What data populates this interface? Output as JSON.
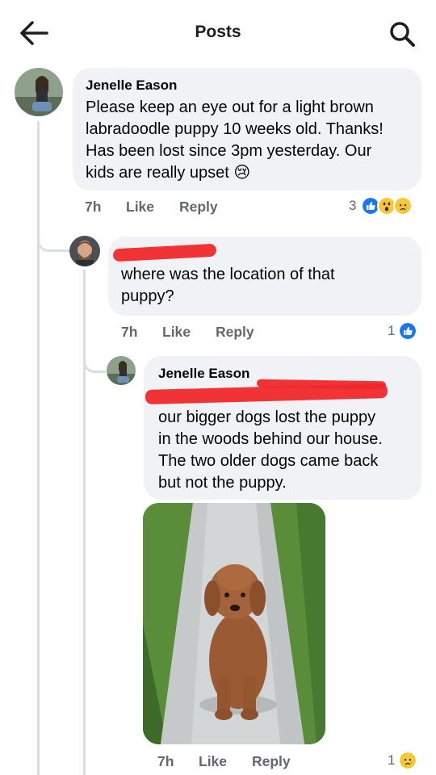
{
  "header": {
    "title": "Posts",
    "back_icon": "arrow-left-icon",
    "search_icon": "search-icon"
  },
  "comments": [
    {
      "author": "Jenelle Eason",
      "text_lines": [
        "Please keep an eye out for a light brown",
        "labradoodle puppy 10 weeks old. Thanks!",
        "Has been lost since 3pm yesterday. Our",
        "kids are really upset 😢"
      ],
      "time": "7h",
      "like": "Like",
      "reply": "Reply",
      "reaction_count": "3"
    },
    {
      "author": "",
      "text_lines": [
        "where was the location of that",
        "puppy?"
      ],
      "time": "7h",
      "like": "Like",
      "reply": "Reply",
      "reaction_count": "1"
    },
    {
      "author": "Jenelle Eason",
      "text_lines": [
        "our bigger dogs lost the puppy",
        "in the woods behind our house.",
        "The two older dogs came back",
        "but not the puppy."
      ],
      "time": "7h",
      "like": "Like",
      "reply": "Reply",
      "reaction_count": "1"
    }
  ],
  "colors": {
    "bubble": "#f0f2f5",
    "meta": "#65676b",
    "like_blue": "#1877f2",
    "redaction": "#f0282b"
  }
}
